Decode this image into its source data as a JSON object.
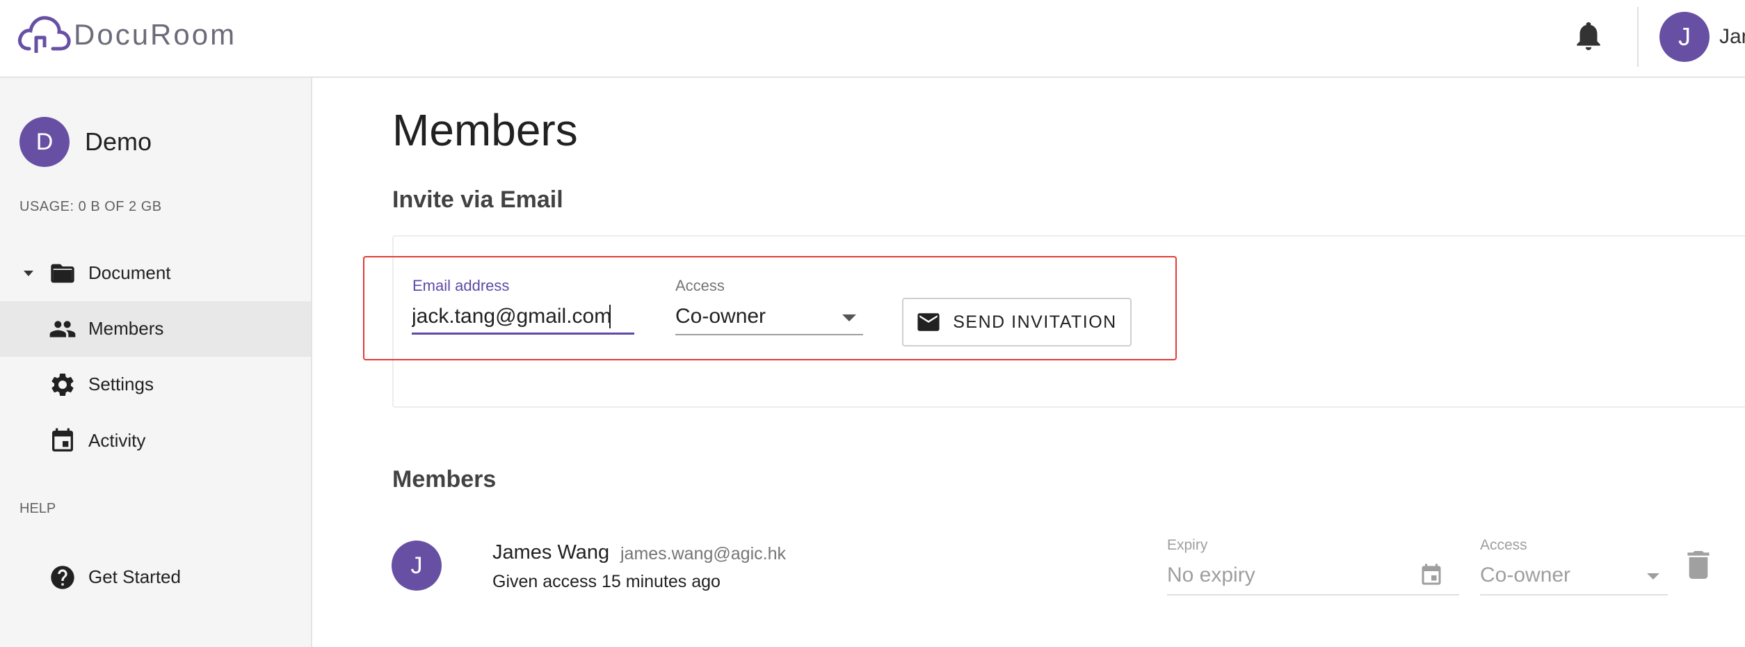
{
  "app": {
    "name": "DocuRoom",
    "accent": "#6750a4",
    "highlight_color": "#e53935"
  },
  "header": {
    "notification_icon": "bell-icon",
    "user_initial": "J",
    "user_name_partial": "Jan"
  },
  "sidebar": {
    "workspace": {
      "initial": "D",
      "name": "Demo"
    },
    "usage": "USAGE: 0 B OF 2 GB",
    "items": [
      {
        "label": "Document",
        "icon": "folder-icon",
        "expandable": true
      },
      {
        "label": "Members",
        "icon": "people-icon",
        "active": true
      },
      {
        "label": "Settings",
        "icon": "gear-icon"
      },
      {
        "label": "Activity",
        "icon": "calendar-icon"
      }
    ],
    "help_section": "HELP",
    "help_items": [
      {
        "label": "Get Started",
        "icon": "help-circle-icon"
      }
    ]
  },
  "main": {
    "title": "Members",
    "invite": {
      "heading": "Invite via Email",
      "email_label": "Email address",
      "email_value": "jack.tang@gmail.com",
      "access_label": "Access",
      "access_value": "Co-owner",
      "send_label": "SEND INVITATION"
    },
    "members": {
      "heading": "Members",
      "list": [
        {
          "initial": "J",
          "name": "James Wang",
          "email": "james.wang@agic.hk",
          "given_access": "Given access 15 minutes ago",
          "expiry_label": "Expiry",
          "expiry_value": "No expiry",
          "access_label": "Access",
          "access_value": "Co-owner"
        }
      ]
    }
  }
}
